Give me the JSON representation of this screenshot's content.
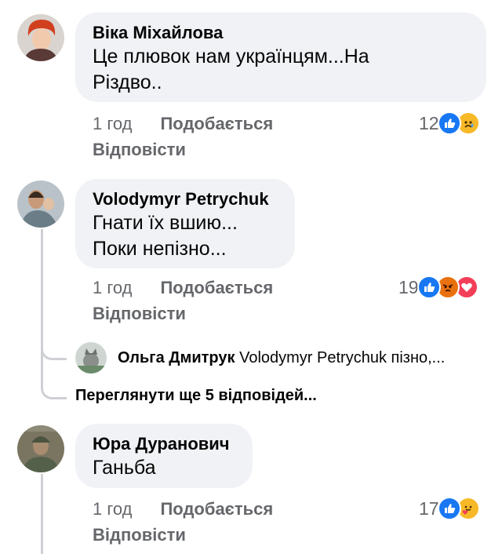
{
  "comments": [
    {
      "author": "Віка Міхайлова",
      "text_lines": [
        "Це плювок нам українцям...На",
        "Різдво.."
      ],
      "time": "1 год",
      "like_label": "Подобається",
      "reply_label": "Відповісти",
      "reaction_count": "12",
      "reactions": [
        "like",
        "sad"
      ]
    },
    {
      "author": "Volodymyr Petrychuk",
      "text_lines": [
        "Гнати їх вшию...",
        "Поки непізно..."
      ],
      "time": "1 год",
      "like_label": "Подобається",
      "reply_label": "Відповісти",
      "reaction_count": "19",
      "reactions": [
        "like",
        "angry",
        "love"
      ],
      "reply_preview": {
        "author": "Ольга Дмитрук",
        "text": "Volodymyr Petrychuk пізно,..."
      },
      "more_replies_label": "Переглянути ще 5 відповідей..."
    },
    {
      "author": "Юра Дуранович",
      "text_lines": [
        "Ганьба"
      ],
      "time": "1 год",
      "like_label": "Подобається",
      "reply_label": "Відповісти",
      "reaction_count": "17",
      "reactions": [
        "like",
        "care"
      ]
    }
  ],
  "colors": {
    "bubble_bg": "#f0f2f5",
    "meta_text": "#65676b",
    "like_blue": "#1877f2",
    "thread_line": "#ced0d4"
  }
}
